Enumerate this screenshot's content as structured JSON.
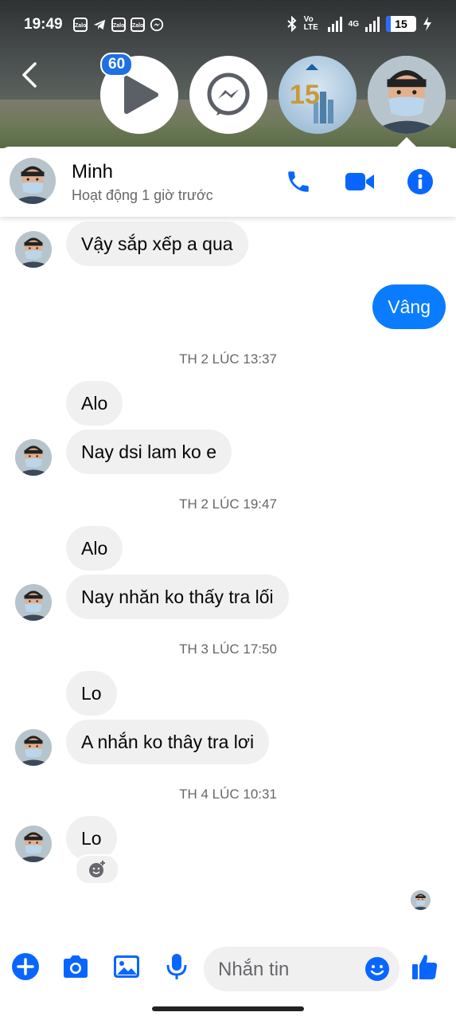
{
  "status_bar": {
    "time": "19:49",
    "app_icons": [
      "Zalo",
      "telegram-icon",
      "Zalo",
      "Zalo",
      "messenger-icon"
    ],
    "network_label": "Vo LTE",
    "network_type": "4G",
    "battery": "15"
  },
  "chat_heads": {
    "badge_count": "60",
    "items": [
      "play-icon",
      "messenger-icon",
      "dat-xanh-group-icon",
      "minh-avatar"
    ]
  },
  "header": {
    "name": "Minh",
    "status": "Hoạt động 1 giờ trước",
    "actions": [
      "phone-icon",
      "video-call-icon",
      "info-icon"
    ]
  },
  "messages": [
    {
      "type": "in",
      "text": "Vậy sắp xếp a qua"
    },
    {
      "type": "out",
      "text": "Vâng"
    },
    {
      "type": "timestamp",
      "text": "TH 2 LÚC 13:37"
    },
    {
      "type": "in",
      "text": "Alo"
    },
    {
      "type": "in",
      "text": "Nay dsi lam ko e"
    },
    {
      "type": "timestamp",
      "text": "TH 2 LÚC 19:47"
    },
    {
      "type": "in",
      "text": "Alo"
    },
    {
      "type": "in",
      "text": "Nay nhăn ko thấy tra lối"
    },
    {
      "type": "timestamp",
      "text": "TH 3 LÚC 17:50"
    },
    {
      "type": "in",
      "text": "Lo"
    },
    {
      "type": "in",
      "text": "A nhắn ko thây tra lơi"
    },
    {
      "type": "timestamp",
      "text": "TH 4 LÚC 10:31"
    },
    {
      "type": "in",
      "text": "Lo"
    }
  ],
  "composer": {
    "placeholder": "Nhắn tin",
    "buttons": [
      "plus-icon",
      "camera-icon",
      "gallery-icon",
      "microphone-icon",
      "emoji-icon",
      "like-icon"
    ]
  },
  "colors": {
    "accent": "#0a7cff",
    "icon_blue": "#0866ff",
    "incoming_bubble": "#f0f0f0",
    "badge": "#1f6fe5"
  }
}
